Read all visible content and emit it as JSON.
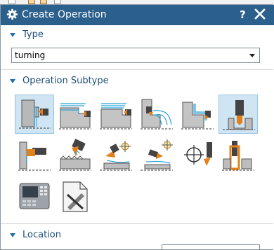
{
  "dialog": {
    "title": "Create Operation",
    "help_label": "?",
    "title_icon": "gear-icon",
    "close_icon": "close-icon"
  },
  "type_section": {
    "label": "Type",
    "selected_value": "turning",
    "options_visible": [
      "turning"
    ]
  },
  "subtype_section": {
    "label": "Operation Subtype",
    "subtypes": [
      {
        "icon": "facing-icon",
        "selected": true
      },
      {
        "icon": "rough-turn-od-icon",
        "selected": false
      },
      {
        "icon": "rough-back-turn-icon",
        "selected": false
      },
      {
        "icon": "rough-bore-id-icon",
        "selected": false
      },
      {
        "icon": "finish-turn-od-icon",
        "selected": false
      },
      {
        "icon": "centerline-drilling-icon",
        "selected": true
      },
      {
        "icon": "groove-od-icon",
        "selected": false
      },
      {
        "icon": "thread-od-icon",
        "selected": false
      },
      {
        "icon": "teach-mode-icon",
        "selected": false
      },
      {
        "icon": "teach-mode-alt-icon",
        "selected": false
      },
      {
        "icon": "centerline-spot-drill-icon",
        "selected": false
      },
      {
        "icon": "parting-icon",
        "selected": false
      },
      {
        "icon": "machine-control-icon",
        "selected": false
      },
      {
        "icon": "user-defined-icon",
        "selected": false
      }
    ]
  },
  "location_section": {
    "label": "Location"
  },
  "colors": {
    "titlebar": "#2b5f8c",
    "section_text": "#1f4e79",
    "toolpath": "#2aa1d6",
    "tool_orange": "#e3801a",
    "selection": "#cfe5f3"
  }
}
